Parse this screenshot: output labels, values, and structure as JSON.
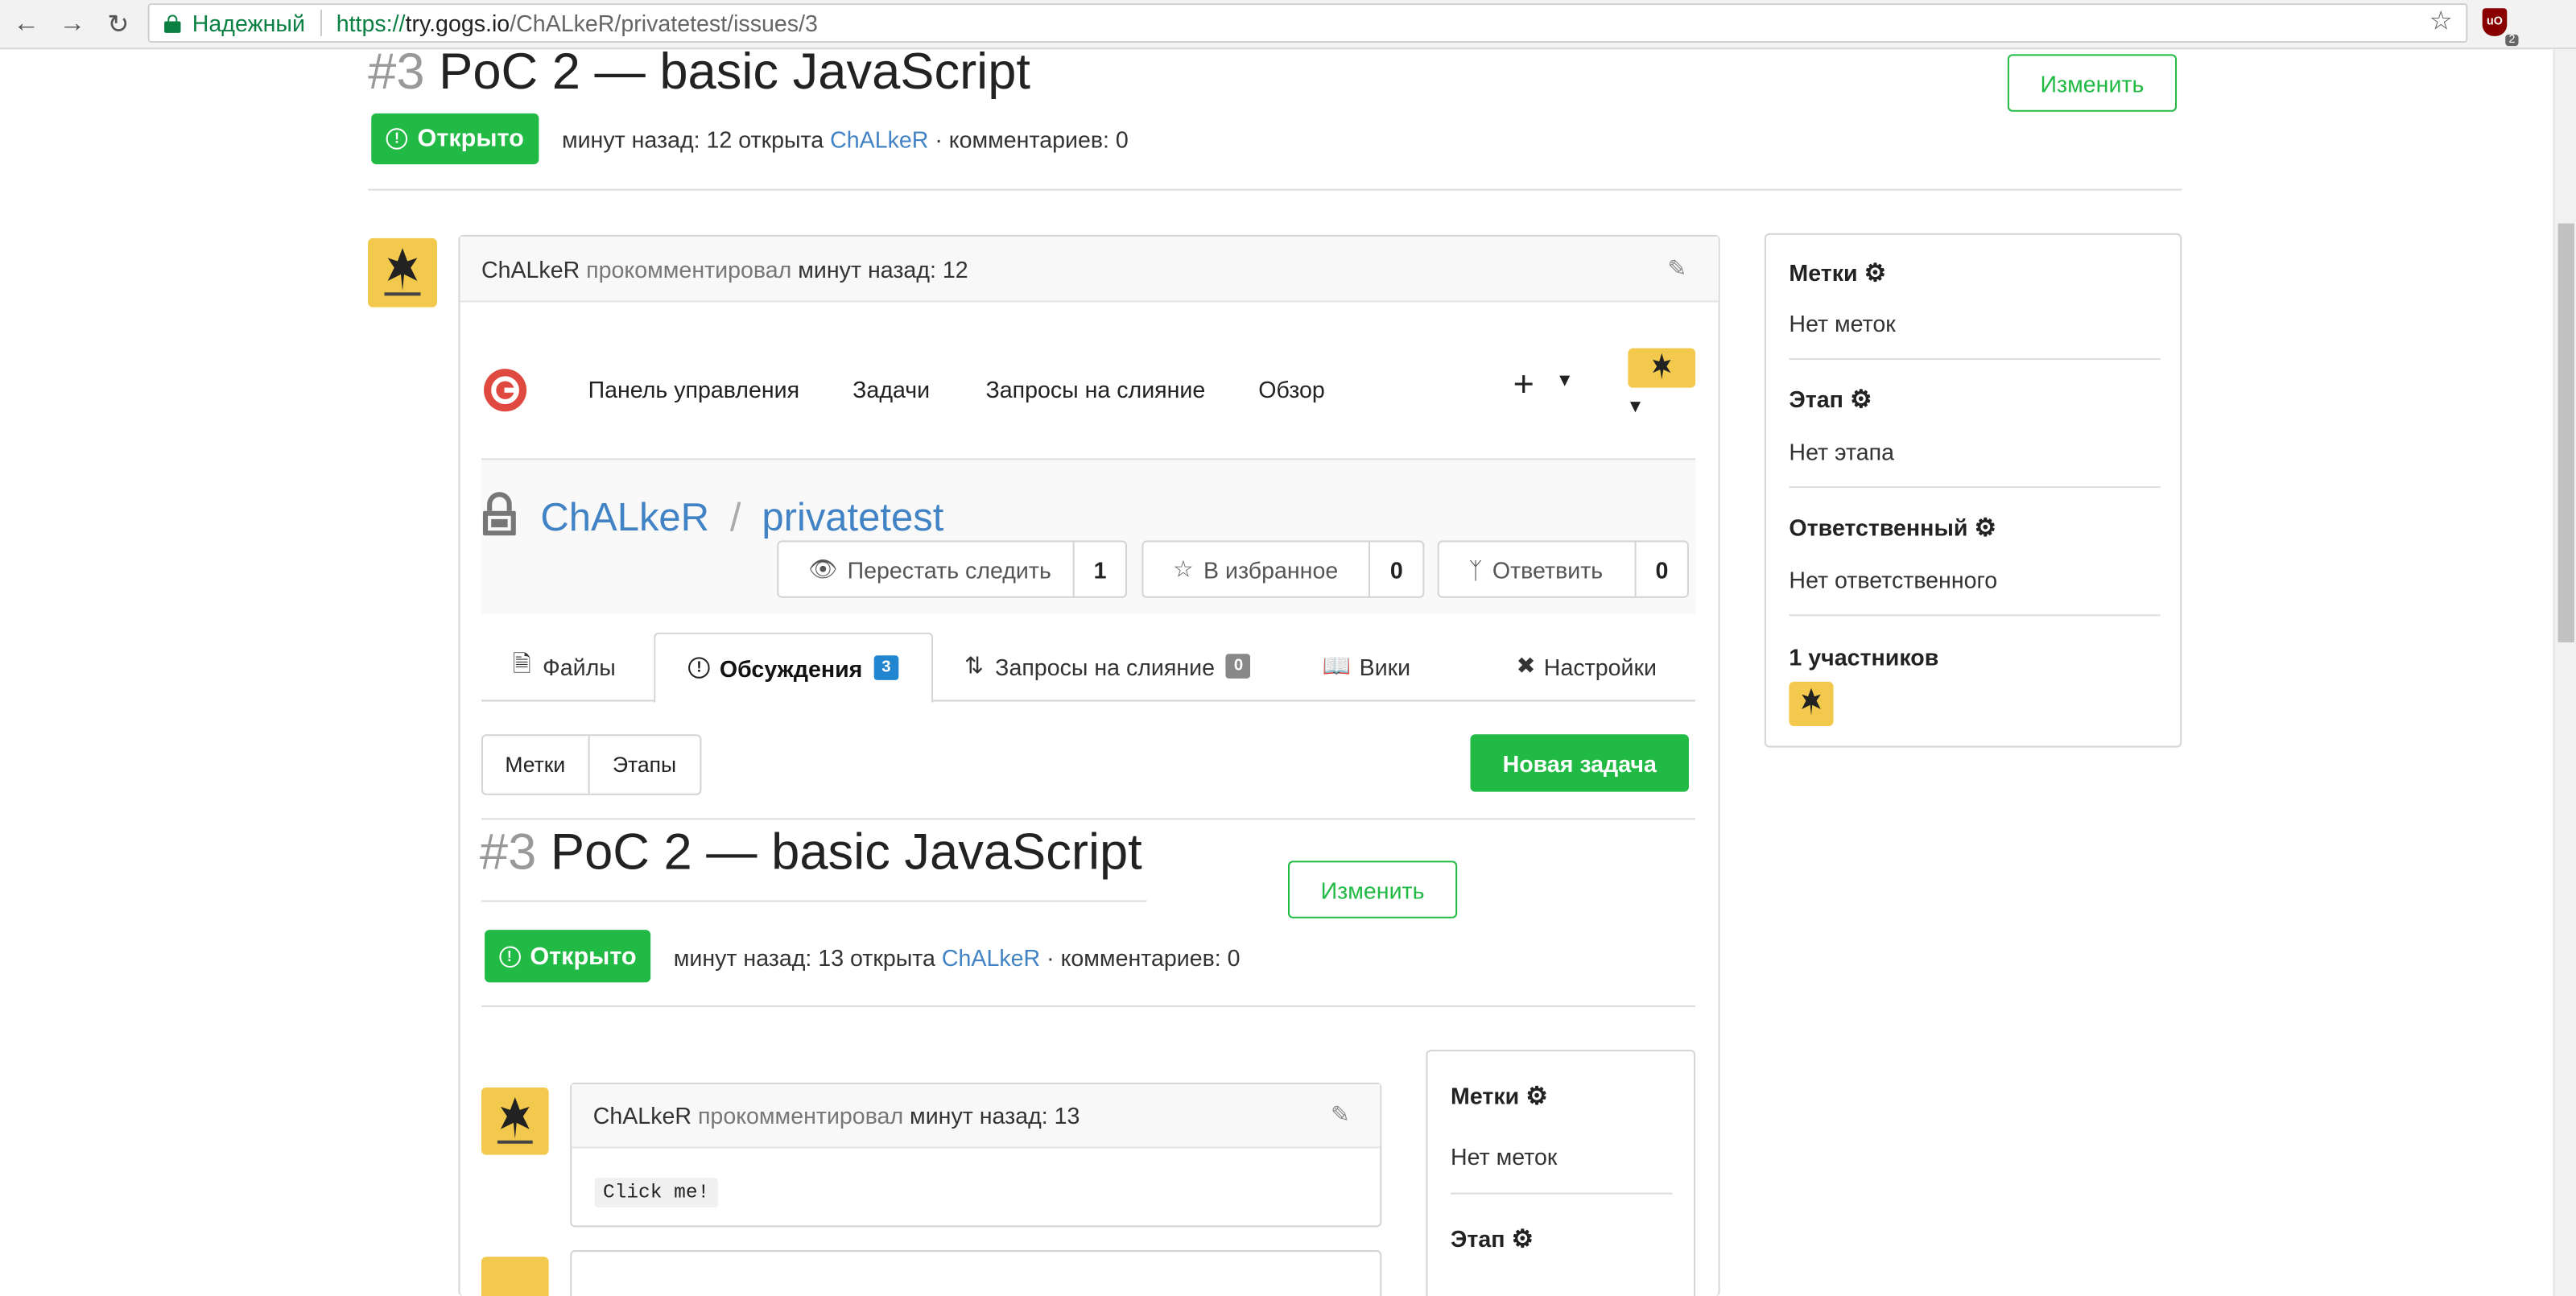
{
  "browser": {
    "secure_label": "Надежный",
    "url_scheme": "https://",
    "url_host": "try.gogs.io",
    "url_path": "/ChALkeR/privatetest/issues/3",
    "extension_badge": "2",
    "extension_label": "uO"
  },
  "issue": {
    "number": "#3",
    "title": "PoC 2 — basic JavaScript",
    "edit_label": "Изменить",
    "status_label": "Открыто",
    "meta_time": "минут назад: 12 открыта",
    "author": "ChALkeR",
    "meta_comments": "· комментариев: 0"
  },
  "comment": {
    "author": "ChALkeR",
    "action": "прокомментировал",
    "time": "минут назад: 12"
  },
  "sidebar": {
    "labels_title": "Метки",
    "labels_value": "Нет меток",
    "milestone_title": "Этап",
    "milestone_value": "Нет этапа",
    "assignee_title": "Ответственный",
    "assignee_value": "Нет ответственного",
    "participants_title": "1 участников"
  },
  "inner": {
    "nav": [
      "Панель управления",
      "Задачи",
      "Запросы на слияние",
      "Обзор"
    ],
    "plus": "+",
    "repo_owner": "ChALkeR",
    "repo_sep": "/",
    "repo_name": "privatetest",
    "watch_label": "Перестать следить",
    "watch_count": "1",
    "star_label": "В избранное",
    "star_count": "0",
    "fork_label": "Ответвить",
    "fork_count": "0",
    "tabs": {
      "files": "Файлы",
      "issues": "Обсуждения",
      "issues_count": "3",
      "pulls": "Запросы на слияние",
      "pulls_count": "0",
      "wiki": "Вики",
      "settings": "Настройки"
    },
    "labels_btn": "Метки",
    "milestones_btn": "Этапы",
    "new_issue": "Новая задача",
    "issue_number": "#3",
    "issue_title": "PoC 2 — basic JavaScript",
    "edit_label": "Изменить",
    "status_label": "Открыто",
    "meta_time": "минут назад: 13 открыта",
    "author": "ChALkeR",
    "meta_comments": "· комментариев: 0",
    "comment_author": "ChALkeR",
    "comment_action": "прокомментировал",
    "comment_time": "минут назад: 13",
    "comment_body": "Click me!",
    "sb_labels_title": "Метки",
    "sb_labels_value": "Нет меток",
    "sb_milestone_title": "Этап"
  },
  "colors": {
    "green": "#21ba45",
    "link": "#4183c4",
    "issues_badge": "#2185d0",
    "pulls_badge": "#888888",
    "avatar_bg": "#f2c94c"
  }
}
